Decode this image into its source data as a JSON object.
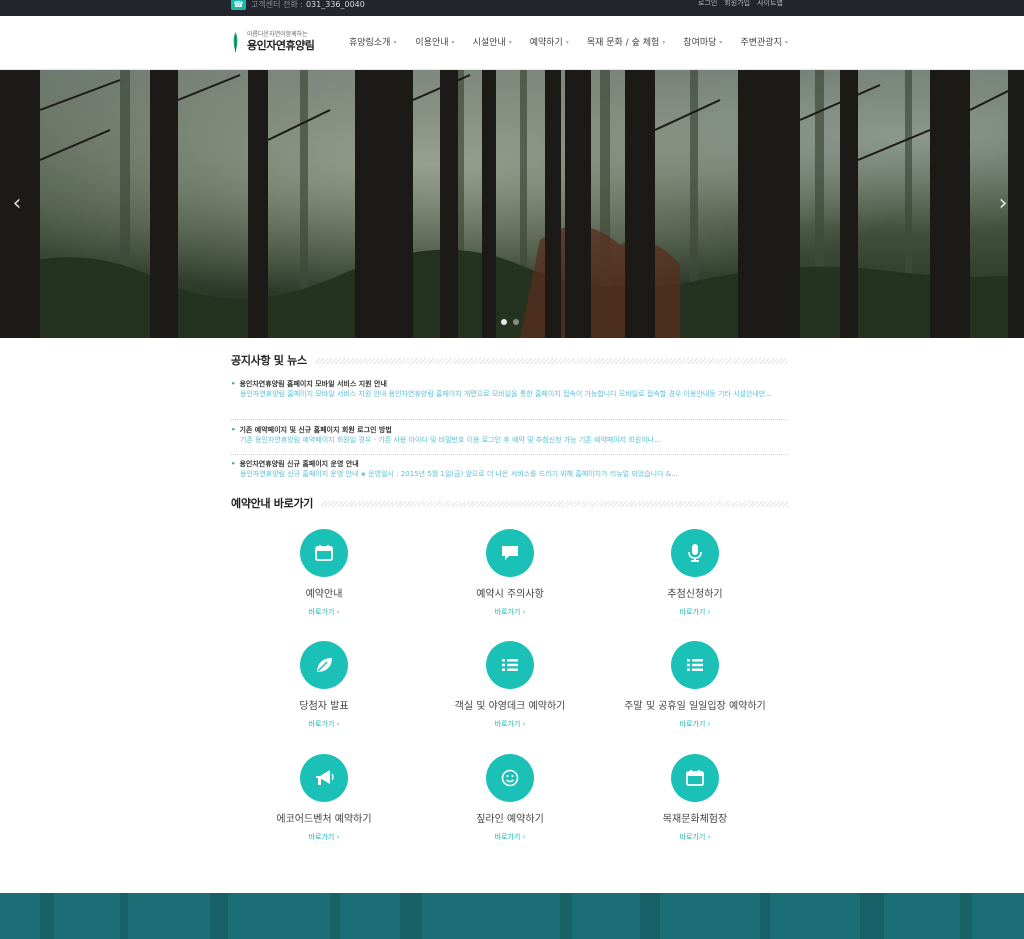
{
  "topbar": {
    "cs_label": "고객센터 전화 :",
    "cs_number": "031_336_0040",
    "links": [
      "로그인",
      "회원가입",
      "사이트맵"
    ]
  },
  "logo": {
    "sub": "아름다운자연이함께하는",
    "main": "용인자연휴양림"
  },
  "nav": [
    "휴양림소개",
    "이용안내",
    "시설안내",
    "예약하기",
    "목재 문화 / 숲 체험",
    "참여마당",
    "주변관광지"
  ],
  "hero": {
    "prev_icon": "‹",
    "next_icon": "›",
    "slides": 2,
    "active_slide": 1
  },
  "news": {
    "title": "공지사항 및 뉴스",
    "items": [
      {
        "title": "용인자연휴양림 홈페이지 모바일 서비스 지원 안내",
        "desc": "용인자연휴양림 홈페이지 모바일 서비스 지원 안내 용인자연휴양림 홈페이지 개편으로 모바일을 통한 홈페이지 접속이 가능합니다 모바일로 접속할 경우 이용안내등 기타 시설안내만..."
      },
      {
        "title": "기존 예약페이지 및 신규 홈페이지 회원 로그인 방법",
        "desc": "기존 용인자연휴양림 예약페이지 회원일 경우    - 기존 사용 아이디 및 비밀번호 이용 로그인 후 예약 및 추첨신청 가능    기존 예약페이지 회원이나..."
      },
      {
        "title": "용인자연휴양림 신규 홈페이지 운영 안내",
        "desc": "용인자연휴양림 신규 홈페이지 운영 안내 ◈ 운영일시 : 2015년 5월 1일(금) 앞으로 더 나은 서비스를 드리기 위해 홈페이지가 리뉴얼 되었습니다 &..."
      }
    ]
  },
  "shortcuts": {
    "title": "예약안내 바로가기",
    "link_label": "바로가기 ›",
    "items": [
      {
        "label": "예약안내",
        "icon": "calendar-icon"
      },
      {
        "label": "예약시 주의사항",
        "icon": "chat-icon"
      },
      {
        "label": "추첨신청하기",
        "icon": "microphone-icon"
      },
      {
        "label": "당첨자 발표",
        "icon": "leaf-icon"
      },
      {
        "label": "객실 및 야영데크 예약하기",
        "icon": "list-icon"
      },
      {
        "label": "주말 및 공휴일 일일입장 예약하기",
        "icon": "list-icon"
      },
      {
        "label": "에코어드벤처 예약하기",
        "icon": "megaphone-icon"
      },
      {
        "label": "짚라인 예약하기",
        "icon": "smile-icon"
      },
      {
        "label": "목재문화체험장",
        "icon": "calendar-icon"
      }
    ]
  },
  "colors": {
    "accent": "#1bc0b6",
    "topbar": "#23262d",
    "footer": "#1a6b73"
  }
}
